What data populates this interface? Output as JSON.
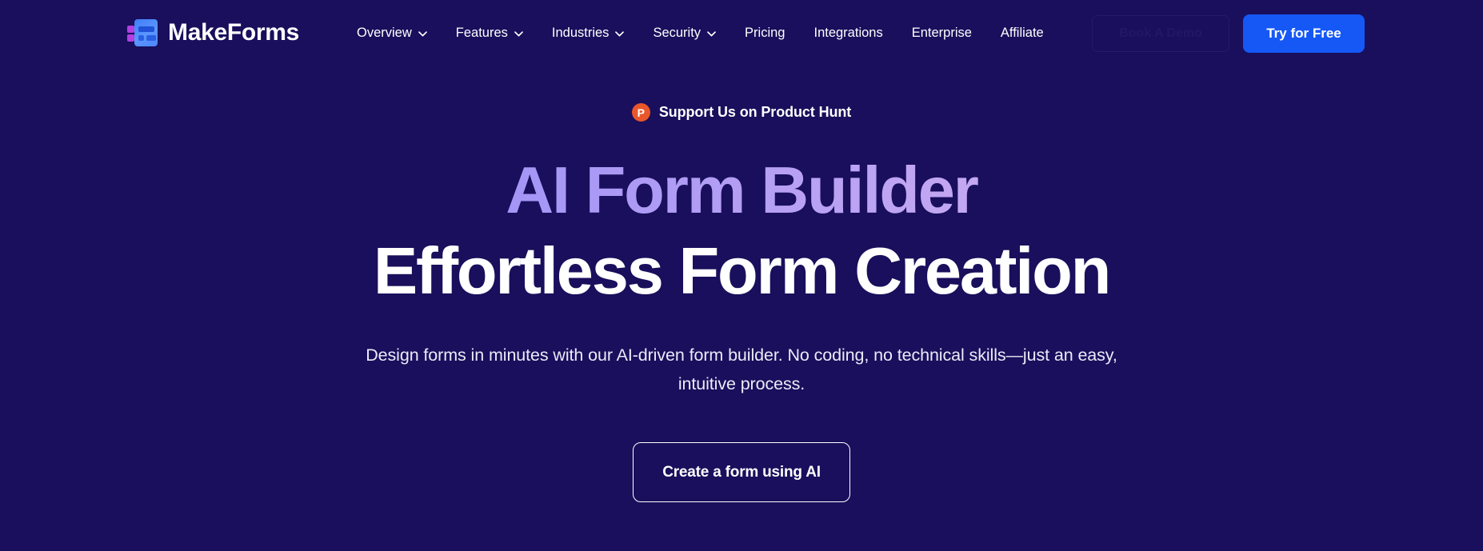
{
  "theme": {
    "background": "#190f5c",
    "accent_blue": "#1558f5",
    "product_hunt_orange": "#e8562a",
    "gradient_start": "#8f8cf7",
    "gradient_end": "#e9bde9"
  },
  "navbar": {
    "brand": {
      "name": "MakeForms",
      "logo_icon": "makeforms-logo-icon"
    },
    "links": [
      {
        "label": "Overview",
        "has_dropdown": true
      },
      {
        "label": "Features",
        "has_dropdown": true
      },
      {
        "label": "Industries",
        "has_dropdown": true
      },
      {
        "label": "Security",
        "has_dropdown": true
      },
      {
        "label": "Pricing",
        "has_dropdown": false
      },
      {
        "label": "Integrations",
        "has_dropdown": false
      },
      {
        "label": "Enterprise",
        "has_dropdown": false
      },
      {
        "label": "Affiliate",
        "has_dropdown": false
      }
    ],
    "actions": {
      "demo_label": "Book A Demo",
      "try_label": "Try for Free"
    }
  },
  "hero": {
    "badge": {
      "icon_letter": "P",
      "text": "Support Us on Product Hunt"
    },
    "title_line_1": "AI Form Builder",
    "title_line_2": "Effortless Form Creation",
    "subtitle": "Design forms in minutes with our AI-driven form builder. No coding, no technical skills—just an easy, intuitive process.",
    "cta_label": "Create a form using AI"
  }
}
